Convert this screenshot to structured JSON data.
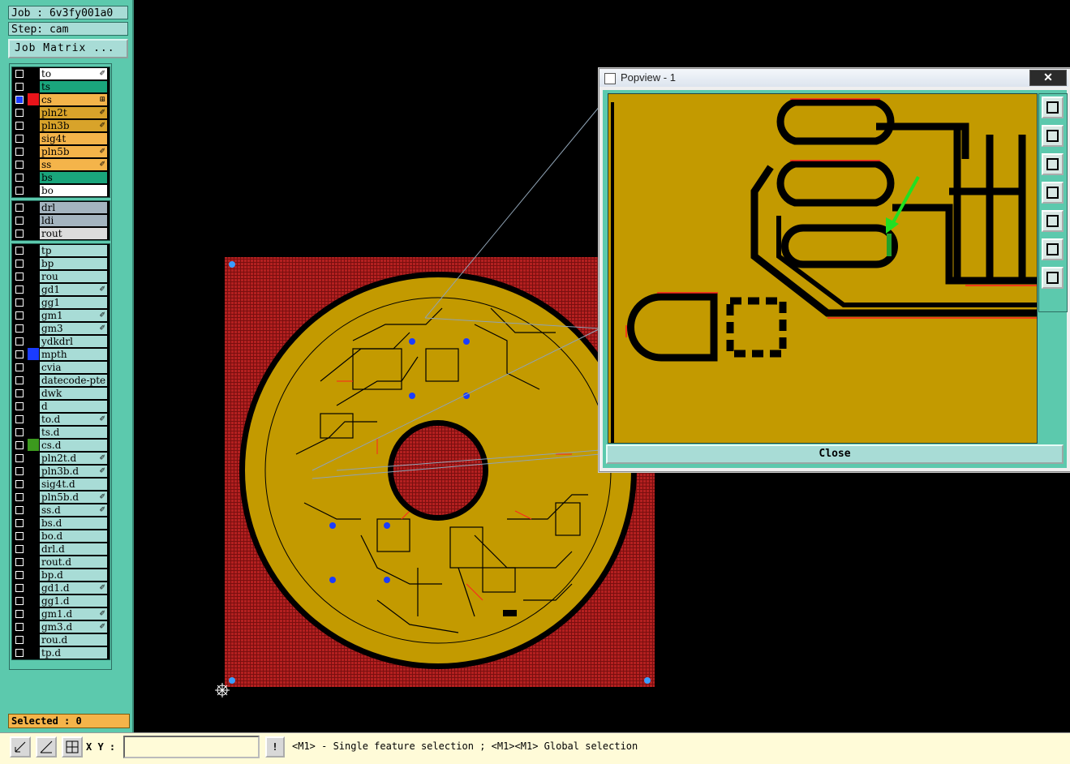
{
  "header": {
    "job": "Job : 6v3fy001a0",
    "step": "Step: cam",
    "job_matrix": "Job Matrix ..."
  },
  "layers_board": [
    {
      "name": "to",
      "bg": "#ffffff",
      "swatch": "#000000",
      "mark": "✐"
    },
    {
      "name": "ts",
      "bg": "#1aa57c",
      "swatch": "#000000",
      "mark": ""
    },
    {
      "name": "cs",
      "bg": "#f4b44a",
      "swatch": "#e8141a",
      "mark": "⊞",
      "checked": true
    },
    {
      "name": "pln2t",
      "bg": "#d8a32a",
      "swatch": "#000000",
      "mark": "✐"
    },
    {
      "name": "pln3b",
      "bg": "#d8a32a",
      "swatch": "#000000",
      "mark": "✐"
    },
    {
      "name": "sig4t",
      "bg": "#f4b44a",
      "swatch": "#000000",
      "mark": ""
    },
    {
      "name": "pln5b",
      "bg": "#f4b44a",
      "swatch": "#000000",
      "mark": "✐"
    },
    {
      "name": "ss",
      "bg": "#f4b44a",
      "swatch": "#000000",
      "mark": "✐"
    },
    {
      "name": "bs",
      "bg": "#1aa57c",
      "swatch": "#000000",
      "mark": ""
    },
    {
      "name": "bo",
      "bg": "#ffffff",
      "swatch": "#000000",
      "mark": ""
    }
  ],
  "layers_drill": [
    {
      "name": "drl",
      "bg": "#a4b4bf",
      "swatch": "#000000",
      "mark": ""
    },
    {
      "name": "ldi",
      "bg": "#a4b4bf",
      "swatch": "#000000",
      "mark": ""
    },
    {
      "name": "rout",
      "bg": "#dcdcdc",
      "swatch": "#000000",
      "mark": ""
    }
  ],
  "layers_misc": [
    {
      "name": "tp",
      "bg": "#a8dcd6",
      "swatch": "#000000",
      "mark": ""
    },
    {
      "name": "bp",
      "bg": "#a8dcd6",
      "swatch": "#000000",
      "mark": ""
    },
    {
      "name": "rou",
      "bg": "#a8dcd6",
      "swatch": "#000000",
      "mark": ""
    },
    {
      "name": "gd1",
      "bg": "#a8dcd6",
      "swatch": "#000000",
      "mark": "✐"
    },
    {
      "name": "gg1",
      "bg": "#a8dcd6",
      "swatch": "#000000",
      "mark": ""
    },
    {
      "name": "gm1",
      "bg": "#a8dcd6",
      "swatch": "#000000",
      "mark": "✐"
    },
    {
      "name": "gm3",
      "bg": "#a8dcd6",
      "swatch": "#000000",
      "mark": "✐"
    },
    {
      "name": "ydkdrl",
      "bg": "#a8dcd6",
      "swatch": "#000000",
      "mark": ""
    },
    {
      "name": "mpth",
      "bg": "#a8dcd6",
      "swatch": "#1a3cff",
      "mark": ""
    },
    {
      "name": "cvia",
      "bg": "#a8dcd6",
      "swatch": "#000000",
      "mark": ""
    },
    {
      "name": "datecode-pte",
      "bg": "#a8dcd6",
      "swatch": "#000000",
      "mark": ""
    },
    {
      "name": "dwk",
      "bg": "#a8dcd6",
      "swatch": "#000000",
      "mark": ""
    },
    {
      "name": "d",
      "bg": "#a8dcd6",
      "swatch": "#000000",
      "mark": ""
    },
    {
      "name": "to.d",
      "bg": "#a8dcd6",
      "swatch": "#000000",
      "mark": "✐"
    },
    {
      "name": "ts.d",
      "bg": "#a8dcd6",
      "swatch": "#000000",
      "mark": ""
    },
    {
      "name": "cs.d",
      "bg": "#a8dcd6",
      "swatch": "#3c9a1e",
      "mark": ""
    },
    {
      "name": "pln2t.d",
      "bg": "#a8dcd6",
      "swatch": "#000000",
      "mark": "✐"
    },
    {
      "name": "pln3b.d",
      "bg": "#a8dcd6",
      "swatch": "#000000",
      "mark": "✐"
    },
    {
      "name": "sig4t.d",
      "bg": "#a8dcd6",
      "swatch": "#000000",
      "mark": ""
    },
    {
      "name": "pln5b.d",
      "bg": "#a8dcd6",
      "swatch": "#000000",
      "mark": "✐"
    },
    {
      "name": "ss.d",
      "bg": "#a8dcd6",
      "swatch": "#000000",
      "mark": "✐"
    },
    {
      "name": "bs.d",
      "bg": "#a8dcd6",
      "swatch": "#000000",
      "mark": ""
    },
    {
      "name": "bo.d",
      "bg": "#a8dcd6",
      "swatch": "#000000",
      "mark": ""
    },
    {
      "name": "drl.d",
      "bg": "#a8dcd6",
      "swatch": "#000000",
      "mark": ""
    },
    {
      "name": "rout.d",
      "bg": "#a8dcd6",
      "swatch": "#000000",
      "mark": ""
    },
    {
      "name": "bp.d",
      "bg": "#a8dcd6",
      "swatch": "#000000",
      "mark": ""
    },
    {
      "name": "gd1.d",
      "bg": "#a8dcd6",
      "swatch": "#000000",
      "mark": "✐"
    },
    {
      "name": "gg1.d",
      "bg": "#a8dcd6",
      "swatch": "#000000",
      "mark": ""
    },
    {
      "name": "gm1.d",
      "bg": "#a8dcd6",
      "swatch": "#000000",
      "mark": "✐"
    },
    {
      "name": "gm3.d",
      "bg": "#a8dcd6",
      "swatch": "#000000",
      "mark": "✐"
    },
    {
      "name": "rou.d",
      "bg": "#a8dcd6",
      "swatch": "#000000",
      "mark": ""
    },
    {
      "name": "tp.d",
      "bg": "#a8dcd6",
      "swatch": "#000000",
      "mark": ""
    }
  ],
  "status": {
    "selected": "Selected : 0",
    "xy_label": "X Y :",
    "xy_value": "",
    "bang": "!",
    "hint": "<M1> - Single feature selection ; <M1><M1> Global selection"
  },
  "popup": {
    "title": "Popview - 1",
    "close_x": "✕",
    "close_button": "Close",
    "tools": [
      "zoom-fit-icon",
      "pan-up-icon",
      "pan-down-icon",
      "pan-left-icon",
      "pan-right-icon",
      "zoom-in-icon",
      "zoom-out-icon"
    ]
  },
  "colors": {
    "panel": "#5cc9ad",
    "board_copper": "#c39a00",
    "board_panel": "#9e1a1a",
    "trace_red": "#ff2020",
    "highlight_green": "#22e022"
  }
}
